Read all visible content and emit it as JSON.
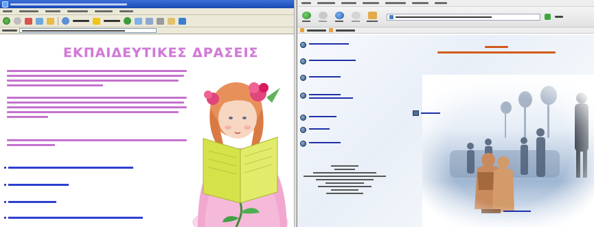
{
  "left_window": {
    "page_title": "ΕΚΠΑΙΔΕΥΤΙΚΕΣ ΔΡΑΣΕΙΣ"
  },
  "colors": {
    "left_title": "#d07ad6",
    "left_body_text": "#b44fc0",
    "left_links": "#2d3fd0",
    "right_links": "#1e2fa8",
    "right_header_text": "#d25a1a",
    "ie_title_bar": "#1a49b3"
  },
  "icons": {
    "left_toolbar": [
      "back-icon",
      "forward-icon",
      "stop-icon",
      "refresh-icon",
      "home-icon",
      "search-icon",
      "favorites-icon",
      "media-icon",
      "history-icon",
      "mail-icon",
      "print-icon",
      "edit-icon",
      "messenger-icon"
    ],
    "right_navbar": [
      "back-icon",
      "forward-icon",
      "reload-icon",
      "stop-icon",
      "home-icon",
      "go-icon"
    ],
    "right_sidebar": "nav-bullet-icon"
  }
}
